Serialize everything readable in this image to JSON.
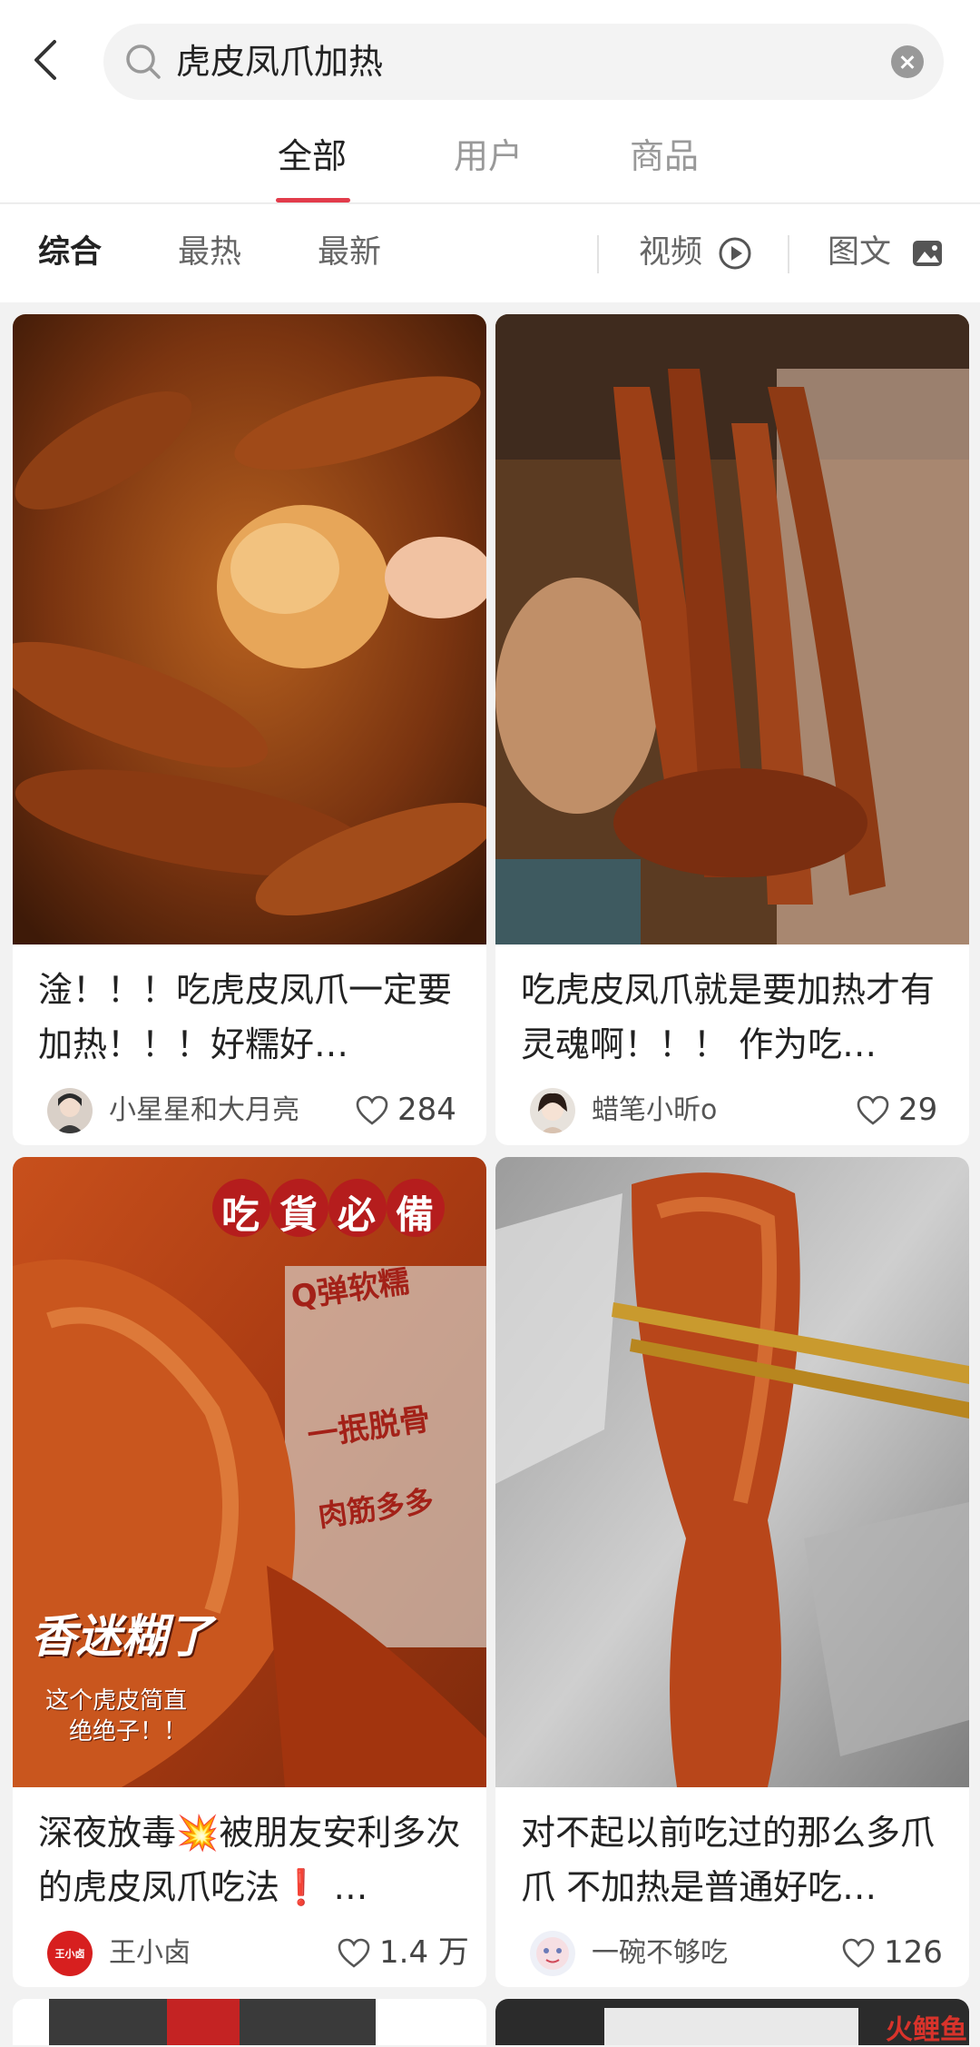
{
  "search": {
    "query": "虎皮凤爪加热"
  },
  "tabs": [
    {
      "label": "全部",
      "active": true
    },
    {
      "label": "用户",
      "active": false
    },
    {
      "label": "商品",
      "active": false
    }
  ],
  "filters": {
    "sort": [
      {
        "label": "综合",
        "active": true
      },
      {
        "label": "最热",
        "active": false
      },
      {
        "label": "最新",
        "active": false
      }
    ],
    "video_label": "视频",
    "image_text_label": "图文"
  },
  "accent_color": "#e23c4b",
  "cards": [
    {
      "title": "淦！！！吃虎皮凤爪一定要加热！！！好糯好…",
      "author": "小星星和大月亮",
      "likes": "284"
    },
    {
      "title": "吃虎皮凤爪就是要加热才有灵魂啊！！！ 作为吃…",
      "author": "蜡笔小昕o",
      "likes": "29"
    },
    {
      "title": "深夜放毒💥被朋友安利多次的虎皮凤爪吃法❗️ …",
      "author": "王小卤",
      "likes": "1.4 万",
      "avatar_text": "王小卤",
      "image_texts": {
        "badge_1": "吃",
        "badge_2": "貨",
        "badge_3": "必",
        "badge_4": "備",
        "tag_1": "Q弹软糯",
        "tag_2": "一抿脱骨",
        "tag_3": "肉筋多多",
        "headline": "香迷糊了",
        "caption_1": "这个虎皮简直",
        "caption_2": "绝绝子！！"
      }
    },
    {
      "title": "对不起以前吃过的那么多爪爪 不加热是普通好吃…",
      "author": "一碗不够吃",
      "likes": "126"
    }
  ],
  "watermark": "火鲤鱼"
}
